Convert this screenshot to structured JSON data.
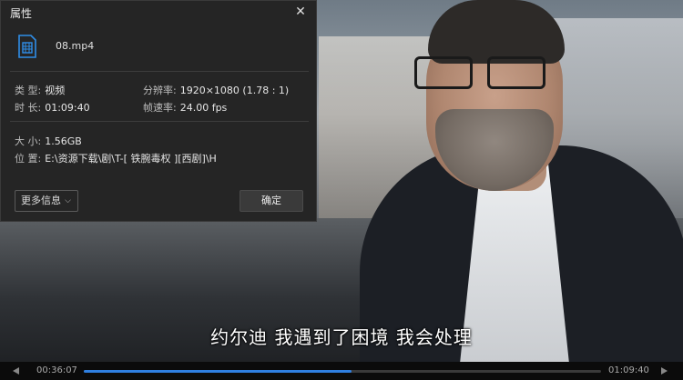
{
  "dialog": {
    "title": "属性",
    "close_symbol": "✕",
    "file_name": "08.mp4",
    "type_label": "类 型:",
    "type_value": "视频",
    "resolution_label": "分辨率:",
    "resolution_value": "1920×1080 (1.78 : 1)",
    "duration_label": "时 长:",
    "duration_value": "01:09:40",
    "framerate_label": "帧速率:",
    "framerate_value": "24.00 fps",
    "size_label": "大 小:",
    "size_value": "1.56GB",
    "location_label": "位 置:",
    "location_value": "E:\\资源下载\\剧\\T-[ 铁腕毒权 ][西剧]\\H",
    "more_info_label": "更多信息",
    "ok_label": "确定"
  },
  "video": {
    "subtitle": "约尔迪 我遇到了困境 我会处理"
  },
  "player": {
    "current_time": "00:36:07",
    "total_time": "01:09:40",
    "progress_fraction": 0.518
  },
  "colors": {
    "accent": "#2f7fe0",
    "dialog_bg": "#252525"
  },
  "icons": {
    "file": "video-file-icon",
    "close": "close-icon",
    "more": "chevron-down-icon"
  }
}
